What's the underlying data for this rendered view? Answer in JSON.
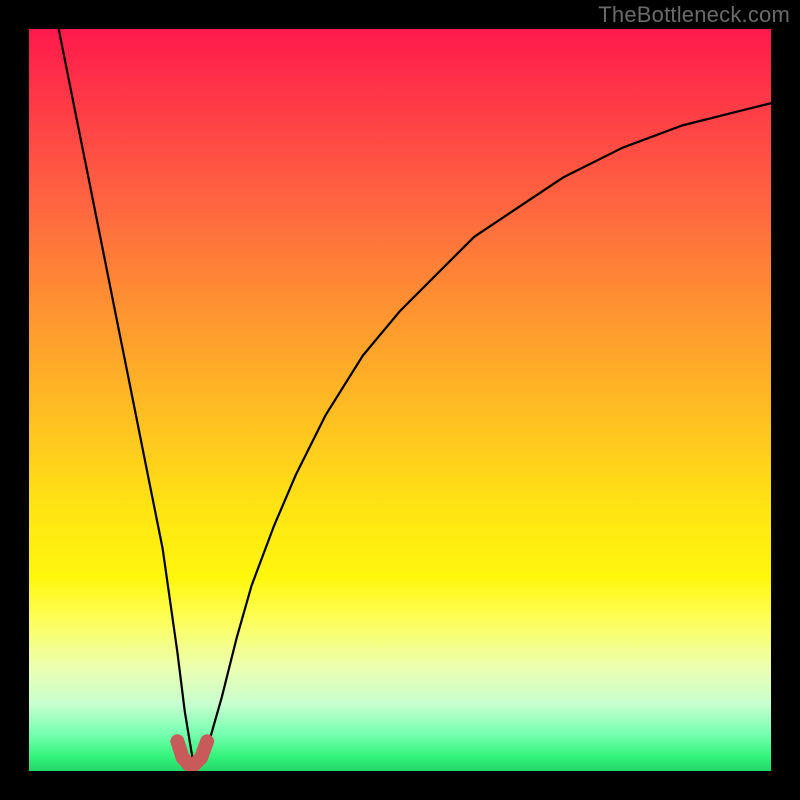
{
  "watermark": "TheBottleneck.com",
  "colors": {
    "frame": "#000000",
    "curve": "#000000",
    "marker": "#c85a5a",
    "gradient_stops": [
      "#ff1a4c",
      "#ff3a47",
      "#ff6a3f",
      "#ff9a2e",
      "#ffc81f",
      "#ffe512",
      "#fff70e",
      "#fcff5e",
      "#ecffb0",
      "#c7ffd0",
      "#76ffb0",
      "#34f57c",
      "#24d66a"
    ]
  },
  "chart_data": {
    "type": "line",
    "title": "",
    "xlabel": "",
    "ylabel": "",
    "xlim": [
      0,
      100
    ],
    "ylim": [
      0,
      100
    ],
    "optimum_x": 22,
    "series": [
      {
        "name": "bottleneck-curve",
        "x": [
          4,
          6,
          8,
          10,
          12,
          14,
          16,
          18,
          20,
          21,
          22,
          23,
          24,
          26,
          28,
          30,
          33,
          36,
          40,
          45,
          50,
          55,
          60,
          66,
          72,
          80,
          88,
          96,
          100
        ],
        "values": [
          100,
          90,
          80,
          70,
          60,
          50,
          40,
          30,
          16,
          8,
          2,
          1,
          3,
          10,
          18,
          25,
          33,
          40,
          48,
          56,
          62,
          67,
          72,
          76,
          80,
          84,
          87,
          89,
          90
        ]
      }
    ],
    "marker": {
      "name": "optimum-region",
      "x": [
        20.0,
        20.7,
        21.5,
        22.3,
        23.2,
        24.0
      ],
      "values": [
        4.0,
        1.8,
        0.9,
        0.9,
        1.8,
        4.0
      ]
    }
  }
}
